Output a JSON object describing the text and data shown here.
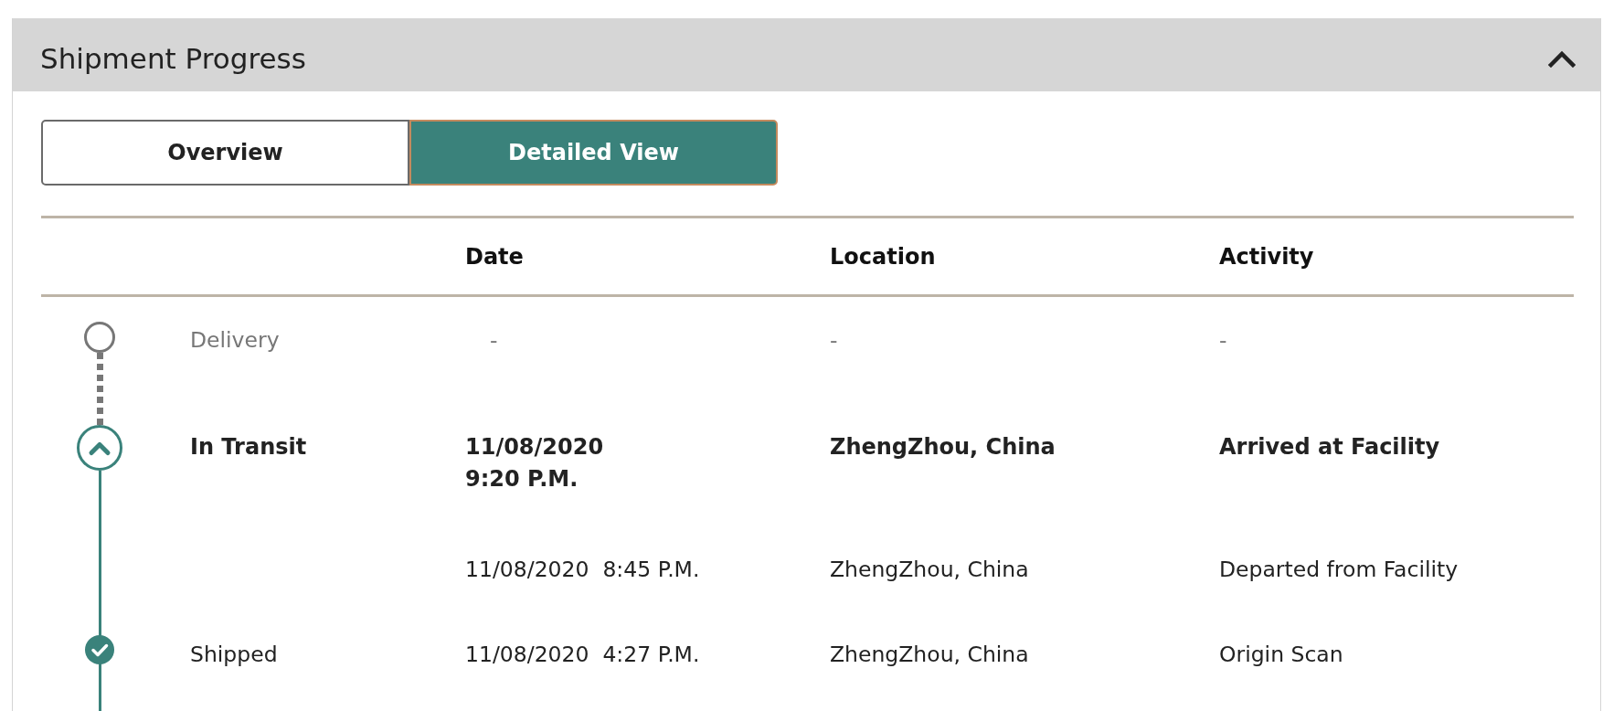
{
  "panel": {
    "title": "Shipment Progress",
    "expanded": true
  },
  "view_tabs": [
    {
      "label": "Overview",
      "selected": false
    },
    {
      "label": "Detailed View",
      "selected": true
    }
  ],
  "table": {
    "columns": [
      "Date",
      "Location",
      "Activity"
    ],
    "rows": [
      {
        "kind": "pending",
        "label": "Delivery",
        "date": "-",
        "location": "-",
        "activity": "-"
      },
      {
        "kind": "current",
        "label": "In Transit",
        "date": "11/08/2020\n9:20 P.M.",
        "location": "ZhengZhou, China",
        "activity": "Arrived at Facility"
      },
      {
        "kind": "event",
        "date": "11/08/2020  8:45 P.M.",
        "location": "ZhengZhou, China",
        "activity": "Departed from Facility"
      },
      {
        "kind": "done",
        "label": "Shipped",
        "date": "11/08/2020  4:27 P.M.",
        "location": "ZhengZhou, China",
        "activity": "Origin Scan"
      }
    ]
  }
}
